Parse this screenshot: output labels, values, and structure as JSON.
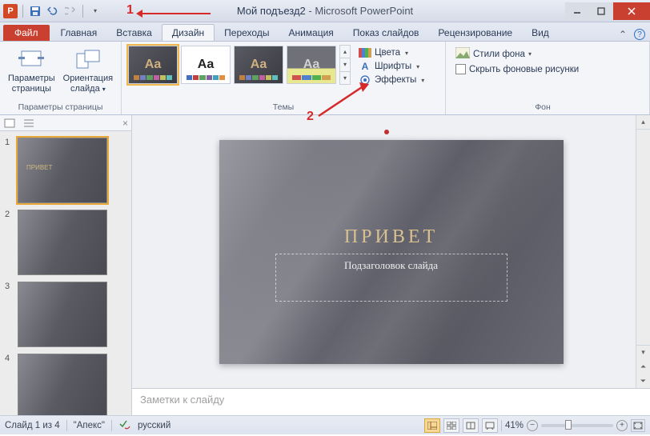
{
  "window": {
    "doc_name": "Мой подъезд2",
    "app_name": "Microsoft PowerPoint"
  },
  "annotations": {
    "label1": "1",
    "label2": "2"
  },
  "tabs": {
    "file": "Файл",
    "home": "Главная",
    "insert": "Вставка",
    "design": "Дизайн",
    "transitions": "Переходы",
    "animations": "Анимация",
    "slideshow": "Показ слайдов",
    "review": "Рецензирование",
    "view": "Вид"
  },
  "ribbon": {
    "page_setup": {
      "page_params": "Параметры\nстраницы",
      "orientation": "Ориентация\nслайда",
      "group_label": "Параметры страницы"
    },
    "themes": {
      "group_label": "Темы",
      "aa": "Aa",
      "colors": "Цвета",
      "fonts": "Шрифты",
      "effects": "Эффекты"
    },
    "background": {
      "styles": "Стили фона",
      "hide_bg": "Скрыть фоновые рисунки",
      "group_label": "Фон"
    }
  },
  "thumbs": {
    "nums": [
      "1",
      "2",
      "3",
      "4"
    ],
    "mini_title": "ПРИВЕТ"
  },
  "slide": {
    "title": "ПРИВЕТ",
    "subtitle": "Подзаголовок слайда"
  },
  "notes": {
    "placeholder": "Заметки к слайду"
  },
  "status": {
    "slide_count": "Слайд 1 из 4",
    "theme": "\"Апекс\"",
    "lang": "русский",
    "zoom": "41%"
  }
}
